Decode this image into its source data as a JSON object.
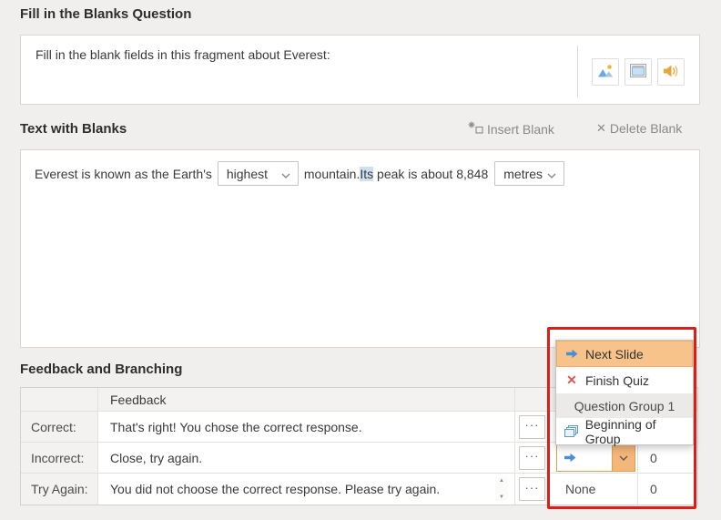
{
  "question_section": {
    "title": "Fill in the Blanks Question",
    "prompt": "Fill in the blank fields in this fragment about Everest:",
    "media_buttons": [
      {
        "icon": "image-icon"
      },
      {
        "icon": "slide-icon"
      },
      {
        "icon": "audio-icon"
      }
    ]
  },
  "blanks_section": {
    "title": "Text with Blanks",
    "insert_blank_label": "Insert Blank",
    "delete_blank_label": "Delete Blank",
    "sentence": {
      "part1": "Everest is known as the Earth's",
      "blank1_value": "highest",
      "part2": "mountain.",
      "selected_word": "Its",
      "part3": " peak is about 8,848",
      "blank2_value": "metres"
    }
  },
  "feedback_section": {
    "title": "Feedback and Branching",
    "column_header": "Feedback",
    "rows": [
      {
        "label": "Correct:",
        "feedback": "That's right! You chose the correct response."
      },
      {
        "label": "Incorrect:",
        "feedback": "Close, try again.",
        "points": "0"
      },
      {
        "label": "Try Again:",
        "feedback": "You did not choose the correct response. Please try again.",
        "branch": "None",
        "points": "0"
      }
    ]
  },
  "branch_menu": {
    "items": [
      {
        "label": "Next Slide",
        "icon": "arrow-right-icon",
        "selected": true
      },
      {
        "label": "Finish Quiz",
        "icon": "x-icon"
      },
      {
        "label": "Question Group 1",
        "group_header": true
      },
      {
        "label": "Beginning of Group",
        "icon": "group-icon"
      }
    ]
  },
  "icons": {
    "more_ellipsis": "···",
    "delete_x": "✕",
    "finish_quiz_x": "✕",
    "spinner_up": "▲",
    "spinner_down": "▼"
  },
  "colors": {
    "accent_orange": "#f7c38b",
    "annotation_red": "#de1d17",
    "arrow_blue": "#4a8fd3",
    "x_red": "#e2574d",
    "selection_blue": "#cfe0f2"
  }
}
